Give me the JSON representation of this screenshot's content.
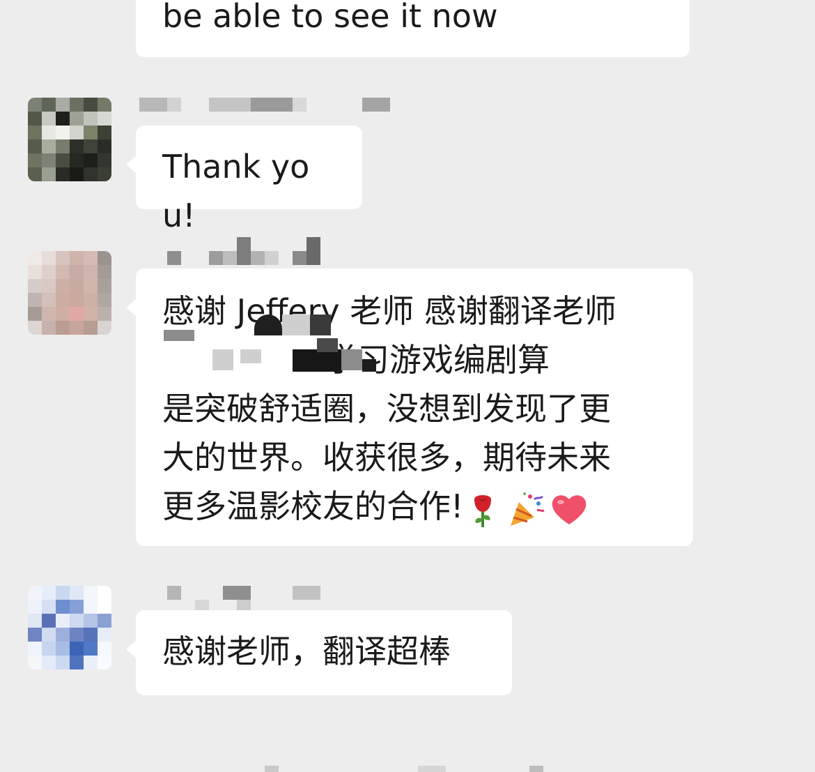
{
  "app": {
    "background_color": "#ededed",
    "bubble_color": "#ffffff"
  },
  "messages": [
    {
      "id": "m0",
      "text": "be able to see it now",
      "sender_redacted": true,
      "avatar_icon": "pixelated-avatar-icon"
    },
    {
      "id": "m1",
      "text": "Thank you!",
      "sender_redacted": true,
      "avatar_icon": "pixelated-avatar-icon"
    },
    {
      "id": "m2",
      "lines": [
        "感谢 Jeffery 老师 感谢翻译老师",
        "                学习游戏编剧算",
        "是突破舒适圈，没想到发现了更",
        "大的世界。收获很多，期待未来",
        "更多温影校友的合作!"
      ],
      "emojis": [
        "rose-icon",
        "party-popper-icon",
        "heart-icon"
      ],
      "sender_redacted": true,
      "avatar_icon": "pixelated-avatar-icon"
    },
    {
      "id": "m3",
      "text": "感谢老师，翻译超棒",
      "sender_redacted": true,
      "avatar_icon": "pixelated-avatar-icon"
    }
  ]
}
